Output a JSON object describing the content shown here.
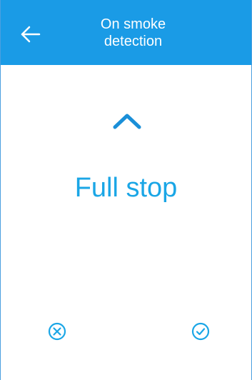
{
  "header": {
    "title_line1": "On smoke",
    "title_line2": "detection",
    "back_icon": "arrow-left-icon"
  },
  "selector": {
    "up_icon": "chevron-up-icon",
    "value": "Full stop"
  },
  "actions": {
    "cancel_icon": "circle-x-icon",
    "confirm_icon": "circle-check-icon"
  },
  "colors": {
    "header_bg": "#1a9be6",
    "accent": "#1aa6e6",
    "text_on_header": "#ffffff"
  }
}
